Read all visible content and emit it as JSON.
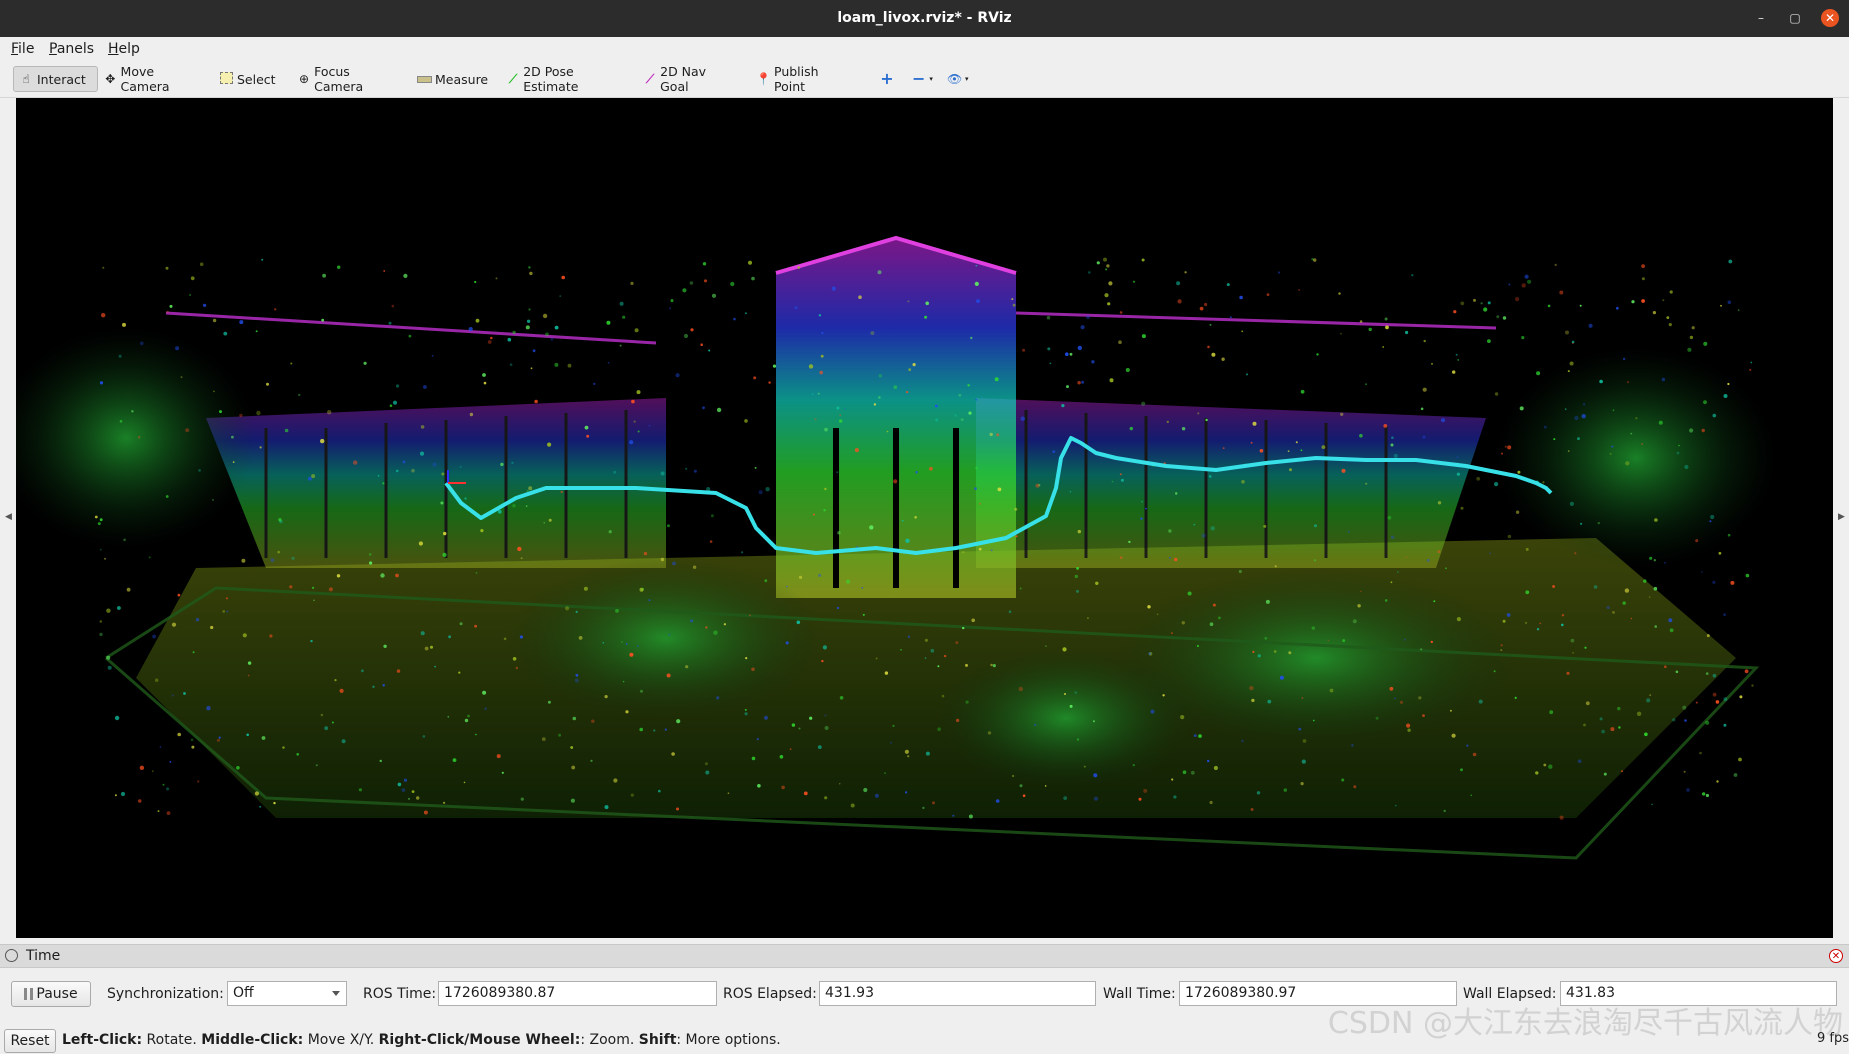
{
  "window": {
    "title": "loam_livox.rviz* - RViz"
  },
  "menubar": {
    "items": [
      {
        "label": "File",
        "mnemonic": "F",
        "rest": "ile"
      },
      {
        "label": "Panels",
        "mnemonic": "P",
        "rest": "anels"
      },
      {
        "label": "Help",
        "mnemonic": "H",
        "rest": "elp"
      }
    ]
  },
  "toolbar": {
    "interact": "Interact",
    "move_camera": "Move Camera",
    "select": "Select",
    "focus_camera": "Focus Camera",
    "measure": "Measure",
    "pose_estimate": "2D Pose Estimate",
    "nav_goal": "2D Nav Goal",
    "publish_point": "Publish Point"
  },
  "time_panel": {
    "title": "Time",
    "pause_label": "Pause",
    "sync_label": "Synchronization:",
    "sync_value": "Off",
    "ros_time_label": "ROS Time:",
    "ros_time": "1726089380.87",
    "ros_elapsed_label": "ROS Elapsed:",
    "ros_elapsed": "431.93",
    "wall_time_label": "Wall Time:",
    "wall_time": "1726089380.97",
    "wall_elapsed_label": "Wall Elapsed:",
    "wall_elapsed": "431.83"
  },
  "status": {
    "reset_label": "Reset",
    "hint_lc_key": "Left-Click:",
    "hint_lc": " Rotate. ",
    "hint_mc_key": "Middle-Click:",
    "hint_mc": " Move X/Y. ",
    "hint_rc_key": "Right-Click/Mouse Wheel:",
    "hint_rc": ": Zoom. ",
    "hint_shift_key": "Shift",
    "hint_shift": ": More options.",
    "fps": "9 fps"
  },
  "watermark": "CSDN @大江东去浪淘尽千古风流人物",
  "colors": {
    "trajectory": "#38e0e8",
    "close_button": "#e95420",
    "titlebar": "#2c2c2c"
  }
}
